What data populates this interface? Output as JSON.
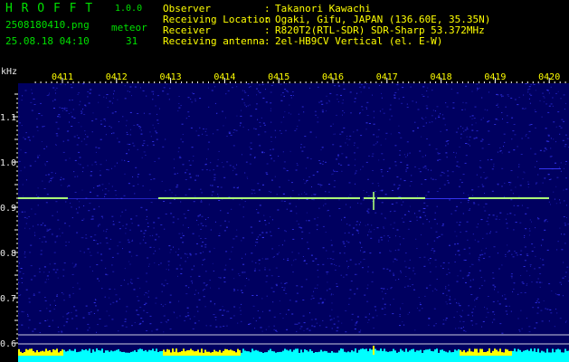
{
  "app": {
    "name": "H R O F F T",
    "version": "1.0.0",
    "file_name": "2508180410.png",
    "datetime": "25.08.18 04:10",
    "counter_label": "meteor",
    "counter_value": "31"
  },
  "info": {
    "rows": [
      {
        "label": "Observer",
        "sep": ":",
        "value": "Takanori Kawachi"
      },
      {
        "label": "Receiving Location",
        "sep": ":",
        "value": "Ogaki, Gifu, JAPAN (136.60E, 35.35N)"
      },
      {
        "label": "Receiver",
        "sep": ":",
        "value": "R820T2(RTL-SDR) SDR-Sharp 53.372MHz"
      },
      {
        "label": "Receiving antenna",
        "sep": ":",
        "value": "2el-HB9CV Vertical (el. E-W)"
      }
    ]
  },
  "plot": {
    "y_unit": "kHz",
    "y_ticks": [
      "1.1",
      "1.0",
      "0.9",
      "0.8",
      "0.7",
      "0.6"
    ],
    "x_ticks": [
      "0411",
      "0412",
      "0413",
      "0414",
      "0415",
      "0416",
      "0417",
      "0418",
      "0419",
      "0420"
    ],
    "colors": {
      "background": "#000060",
      "noise": "#3a3aff",
      "carrier": "#aaff77",
      "tick": "#ffffff",
      "x_label": "#ffff00",
      "y_label": "#e8e8e8",
      "level_cyan": "#00ffff",
      "level_yellow": "#ffff00"
    }
  }
}
